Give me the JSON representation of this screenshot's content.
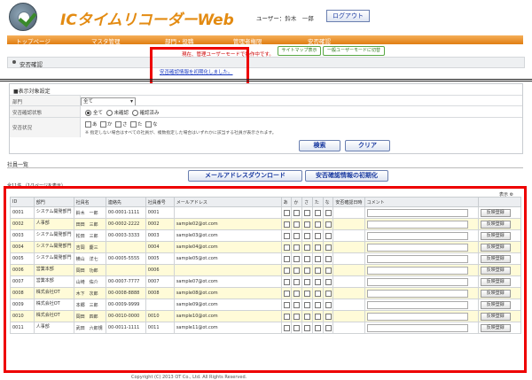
{
  "header": {
    "app_title": "ICタイムリコーダーWeb",
    "user_label": "ユーザー：鈴木　一郎",
    "logout_label": "ログアウト"
  },
  "nav": {
    "items": [
      {
        "label": "トップページ"
      },
      {
        "label": "マスタ管理"
      },
      {
        "label": "部門・役職"
      },
      {
        "label": "管理者権限"
      },
      {
        "label": "安否確認"
      }
    ]
  },
  "subbar": {
    "note": "現在、管理ユーザーモードで操作中です。",
    "sitemap_label": "サイトマップ表示",
    "switch_label": "一般ユーザーモードに切替"
  },
  "page": {
    "title": "安否確認",
    "info_message": "安否確認情報を初期化しました。"
  },
  "filter": {
    "title": "■表示対象設定",
    "dept_label": "部門",
    "dept_value": "全て",
    "status_label": "安否確認状態",
    "status_options": [
      "全て",
      "未確認",
      "確認済み"
    ],
    "situation_label": "安否状況",
    "situation_options": [
      "あ",
      "か",
      "さ",
      "た",
      "な"
    ],
    "situation_note": "※ 指定しない場合はすべての社員が、複数指定した場合はいずれかに該当する社員が表示されます。",
    "search_label": "検索",
    "clear_label": "クリア"
  },
  "list": {
    "section_title": "社員一覧",
    "download_label": "メールアドレスダウンロード",
    "reset_label": "安否確認情報の初期化",
    "count_text": "全11件 （1/1ページを表示）",
    "settings_link": "表示 ⚙",
    "columns": [
      "ID",
      "部門",
      "社員名",
      "連絡先",
      "社員番号",
      "メールアドレス",
      "あ",
      "か",
      "さ",
      "た",
      "な",
      "安否確認日時",
      "コメント",
      ""
    ],
    "update_label": "反映登録",
    "rows": [
      {
        "id": "0001",
        "dept": "システム開発部門",
        "name": "鈴木　一郎",
        "phone": "00-0001-1111",
        "emp": "0001",
        "mail": ""
      },
      {
        "id": "0002",
        "dept": "人事部",
        "name": "田田　三郎",
        "phone": "00-0002-2222",
        "emp": "0002",
        "mail": "sample02@ot.com"
      },
      {
        "id": "0003",
        "dept": "システム開発部門",
        "name": "松田　三郎",
        "phone": "00-0003-3333",
        "emp": "0003",
        "mail": "sample03@ot.com"
      },
      {
        "id": "0004",
        "dept": "システム開発部門",
        "name": "吉岡　慶三",
        "phone": "",
        "emp": "0004",
        "mail": "sample04@ot.com"
      },
      {
        "id": "0005",
        "dept": "システム開発部門",
        "name": "横山　洋七",
        "phone": "00-0005-5555",
        "emp": "0005",
        "mail": "sample05@ot.com"
      },
      {
        "id": "0006",
        "dept": "営業本部",
        "name": "岡田　功郎",
        "phone": "",
        "emp": "0006",
        "mail": ""
      },
      {
        "id": "0007",
        "dept": "営業本部",
        "name": "山崎　佑介",
        "phone": "00-0007-7777",
        "emp": "0007",
        "mail": "sample07@ot.com"
      },
      {
        "id": "0008",
        "dept": "株式会社OT",
        "name": "木下　次郎",
        "phone": "00-0008-8888",
        "emp": "0008",
        "mail": "sample08@ot.com"
      },
      {
        "id": "0009",
        "dept": "株式会社OT",
        "name": "本郷　三郎",
        "phone": "00-0009-9999",
        "emp": "",
        "mail": "sample09@ot.com"
      },
      {
        "id": "0010",
        "dept": "株式会社OT",
        "name": "岡田　四郎",
        "phone": "00-0010-0000",
        "emp": "0010",
        "mail": "sample10@ot.com"
      },
      {
        "id": "0011",
        "dept": "人事部",
        "name": "武田　六郎規",
        "phone": "00-0011-1111",
        "emp": "0011",
        "mail": "sample11@ot.com"
      }
    ]
  },
  "footer": {
    "text": "Copyright (C) 2013 OT Co., Ltd. All Rights Reserved."
  }
}
